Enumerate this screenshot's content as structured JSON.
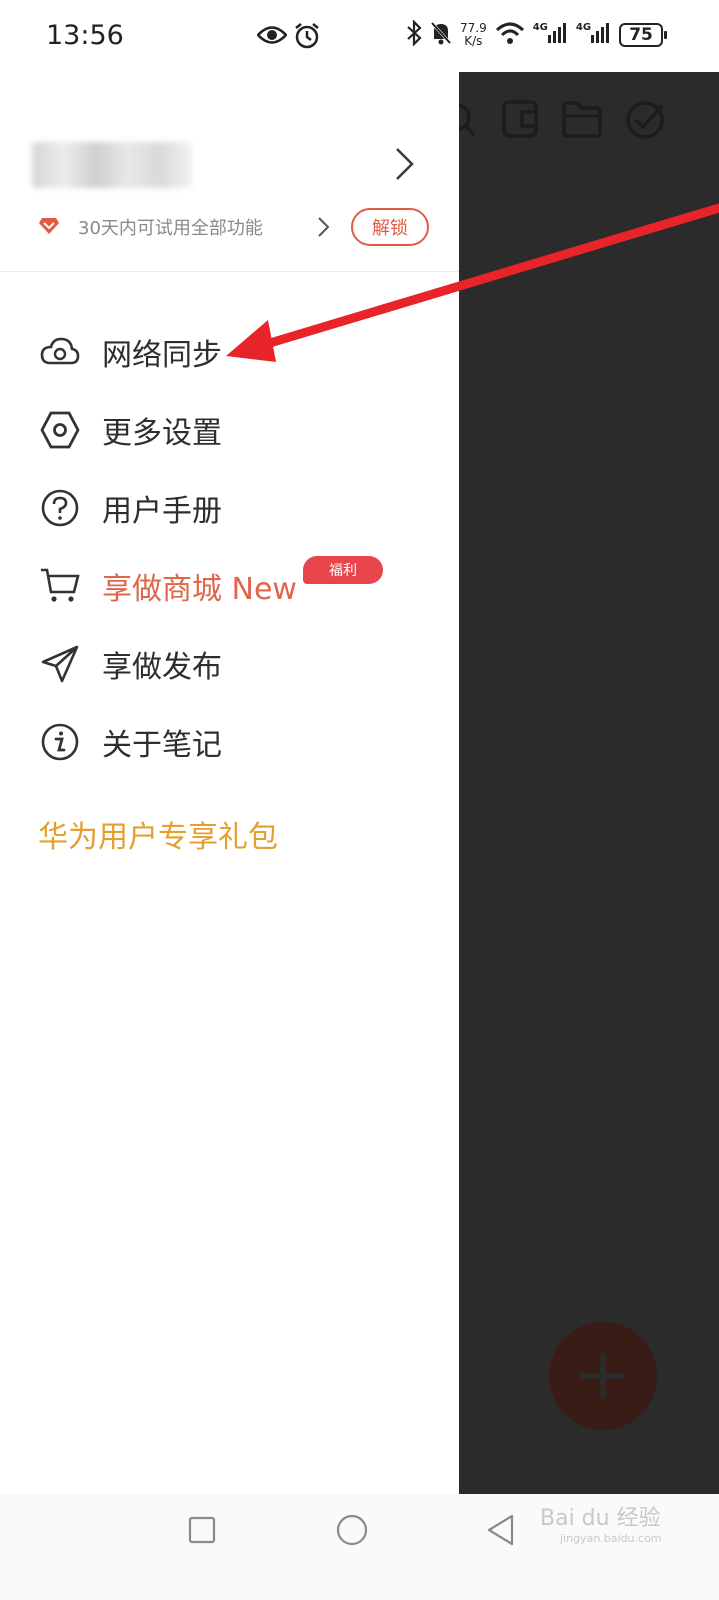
{
  "status_bar": {
    "time": "13:56",
    "net_speed_value": "77.9",
    "net_speed_unit": "K/s",
    "network_1": "4G",
    "network_2": "4G",
    "battery": "75",
    "icons": [
      "eye-icon",
      "alarm-icon",
      "bluetooth-icon",
      "mute-bell-icon",
      "wifi-icon",
      "signal-icon",
      "signal-icon",
      "battery-icon"
    ]
  },
  "drawer": {
    "trial": {
      "text": "30天内可试用全部功能",
      "unlock_label": "解锁"
    },
    "menu": [
      {
        "label": "网络同步",
        "icon": "cloud-sync-icon"
      },
      {
        "label": "更多设置",
        "icon": "settings-hexagon-icon"
      },
      {
        "label": "用户手册",
        "icon": "help-circle-icon"
      },
      {
        "label": "享做商城 New",
        "icon": "shopping-cart-icon",
        "badge": "福利"
      },
      {
        "label": "享做发布",
        "icon": "paper-plane-icon"
      },
      {
        "label": "关于笔记",
        "icon": "info-circle-icon"
      }
    ],
    "promo": "华为用户专享礼包"
  },
  "background_app": {
    "toolbar_icons": [
      "search-icon",
      "wallet-icon",
      "folder-icon",
      "check-circle-icon"
    ],
    "fab_icon": "plus-icon"
  },
  "watermark": {
    "text": "Bai du 经验",
    "sub": "jingyan.baidu.com"
  },
  "colors": {
    "accent": "#e05c43",
    "promo": "#e3a02e",
    "badge": "#e8464c",
    "annotation_arrow": "#e8232a",
    "overlay": "#2b2b2b"
  }
}
